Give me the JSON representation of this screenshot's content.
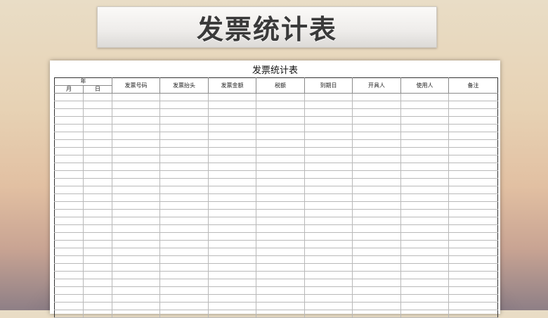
{
  "banner": {
    "title": "发票统计表"
  },
  "sheet": {
    "title": "发票统计表",
    "header": {
      "year_group": "年",
      "month": "月",
      "day": "日",
      "columns": [
        "发票号码",
        "发票抬头",
        "发票金额",
        "税额",
        "到期日",
        "开具人",
        "使用人",
        "备注"
      ]
    },
    "empty_rows": 29
  }
}
